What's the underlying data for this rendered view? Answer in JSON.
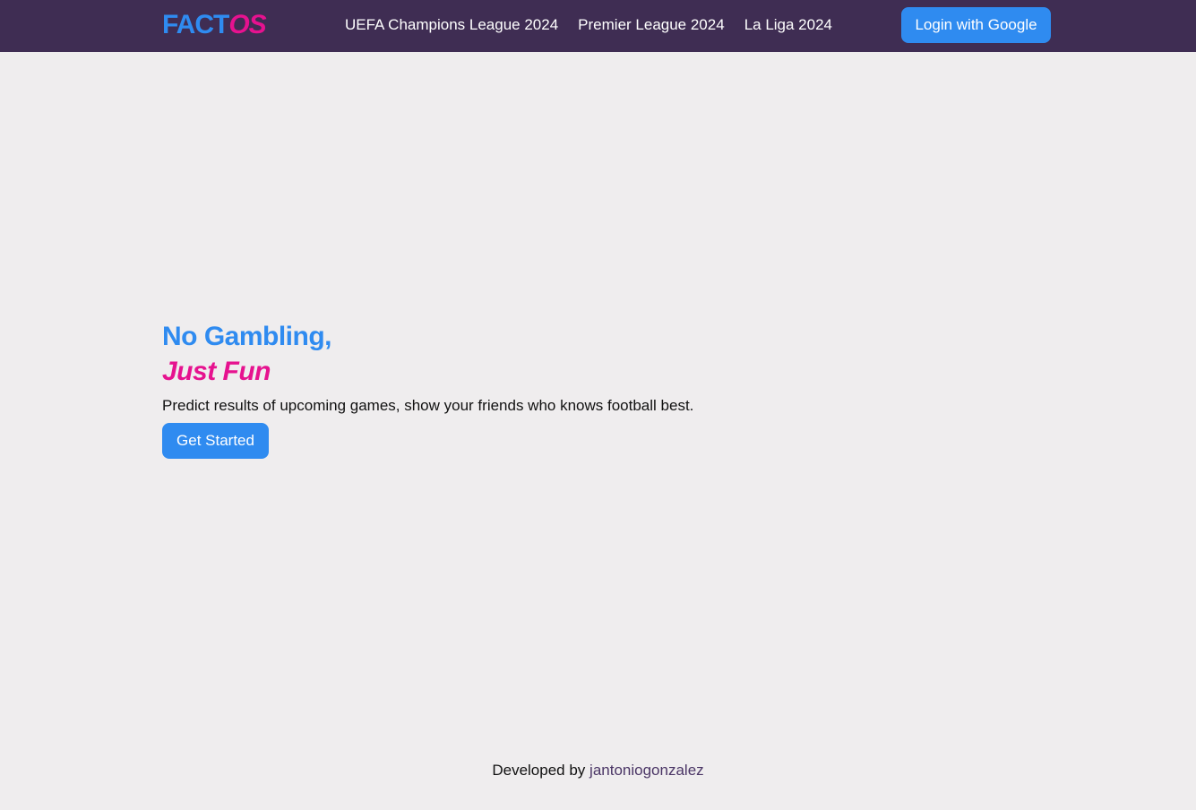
{
  "header": {
    "logo_part_a": "FACT",
    "logo_part_b": "OS",
    "nav": [
      {
        "label": "UEFA Champions League 2024"
      },
      {
        "label": "Premier League 2024"
      },
      {
        "label": "La Liga 2024"
      }
    ],
    "login_label": "Login with Google"
  },
  "hero": {
    "headline_line1": "No Gambling,",
    "headline_line2": "Just Fun",
    "tagline": "Predict results of upcoming games, show your friends who knows football best.",
    "cta_label": "Get Started"
  },
  "footer": {
    "prefix": "Developed by",
    "author": "jantoniogonzalez"
  },
  "colors": {
    "navbar_bg": "#3f2d53",
    "accent_blue": "#2f8bf0",
    "accent_pink": "#e6128f",
    "page_bg": "#efedee"
  }
}
